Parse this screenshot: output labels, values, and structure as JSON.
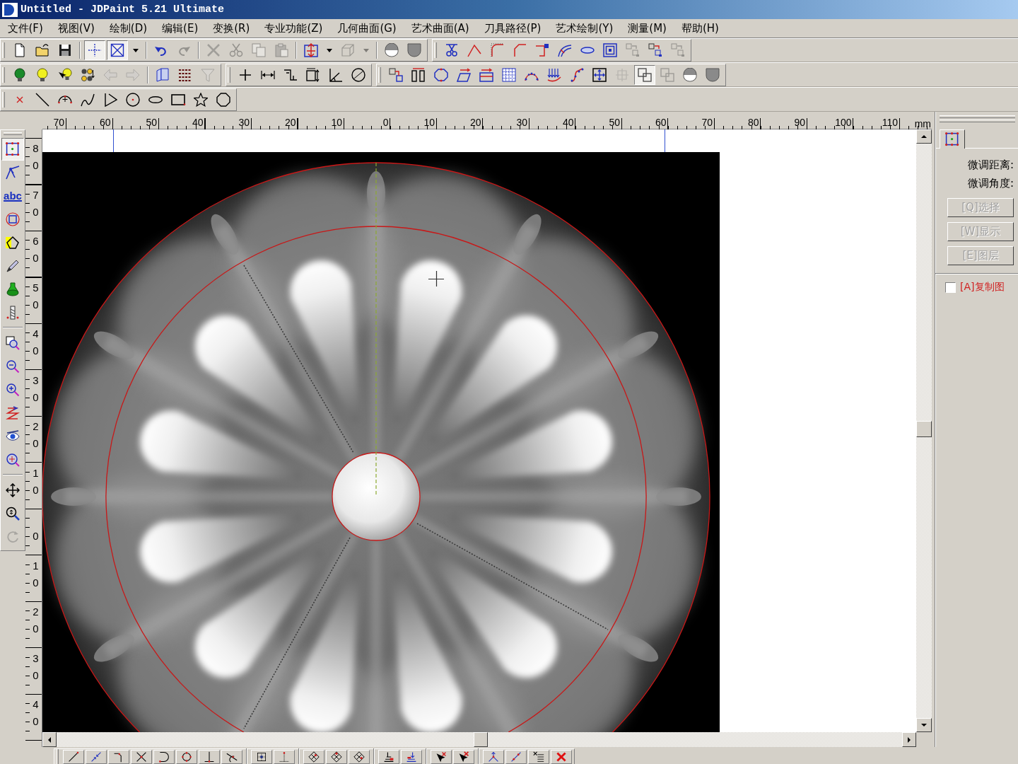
{
  "window": {
    "title": "Untitled - JDPaint 5.21 Ultimate"
  },
  "menu": [
    "文件(F)",
    "视图(V)",
    "绘制(D)",
    "编辑(E)",
    "变换(R)",
    "专业功能(Z)",
    "几何曲面(G)",
    "艺术曲面(A)",
    "刀具路径(P)",
    "艺术绘制(Y)",
    "测量(M)",
    "帮助(H)"
  ],
  "toolbar_rows": [
    {
      "toolbars": [
        {
          "groups": [
            [
              {
                "disabled": false,
                "pressed": false
              },
              {
                "disabled": false,
                "pressed": false
              },
              {
                "disabled": false,
                "pressed": false
              }
            ],
            [
              {
                "kind": "tool",
                "disabled": false,
                "pressed": true
              },
              {
                "kind": "tool",
                "disabled": false,
                "pressed": true
              },
              {
                "kind": "dropdown",
                "disabled": false,
                "pressed": false
              }
            ],
            [
              {
                "disabled": false,
                "pressed": false
              },
              {
                "disabled": true,
                "pressed": false
              }
            ],
            [
              {
                "disabled": true,
                "pressed": false
              },
              {
                "disabled": true,
                "pressed": false
              },
              {
                "disabled": true,
                "pressed": false
              },
              {
                "disabled": true,
                "pressed": false
              }
            ],
            [
              {
                "kind": "tool",
                "disabled": false,
                "pressed": false
              },
              {
                "kind": "dropdown",
                "disabled": false,
                "pressed": false
              },
              {
                "kind": "tool",
                "disabled": true,
                "pressed": false
              },
              {
                "kind": "dropdown",
                "disabled": true,
                "pressed": false
              }
            ],
            [
              {
                "disabled": false,
                "pressed": false
              },
              {
                "disabled": false,
                "pressed": false
              }
            ]
          ]
        },
        {
          "groups": [
            [
              {
                "disabled": false,
                "pressed": false
              },
              {
                "disabled": false,
                "pressed": false
              },
              {
                "disabled": false,
                "pressed": false
              },
              {
                "disabled": false,
                "pressed": false
              },
              {
                "disabled": false,
                "pressed": false
              },
              {
                "disabled": false,
                "pressed": false
              },
              {
                "disabled": false,
                "pressed": false
              },
              {
                "disabled": false,
                "pressed": false
              },
              {
                "disabled": true,
                "pressed": false
              },
              {
                "disabled": false,
                "pressed": false
              },
              {
                "disabled": true,
                "pressed": false
              }
            ]
          ]
        }
      ]
    },
    {
      "toolbars": [
        {
          "groups": [
            [
              {
                "disabled": false,
                "pressed": false
              },
              {
                "disabled": false,
                "pressed": false
              },
              {
                "disabled": false,
                "pressed": false
              },
              {
                "disabled": false,
                "pressed": false
              },
              {
                "disabled": true,
                "pressed": false
              },
              {
                "disabled": true,
                "pressed": false
              }
            ],
            [
              {
                "disabled": false,
                "pressed": false
              },
              {
                "disabled": false,
                "pressed": false
              },
              {
                "disabled": true,
                "pressed": false
              }
            ]
          ]
        },
        {
          "groups": [
            [
              {
                "disabled": false,
                "pressed": false
              },
              {
                "disabled": false,
                "pressed": false
              },
              {
                "disabled": false,
                "pressed": false
              },
              {
                "disabled": false,
                "pressed": false
              },
              {
                "disabled": false,
                "pressed": false
              },
              {
                "disabled": false,
                "pressed": false
              }
            ]
          ]
        },
        {
          "groups": [
            [
              {
                "disabled": false,
                "pressed": false
              },
              {
                "disabled": false,
                "pressed": false
              },
              {
                "disabled": false,
                "pressed": false
              },
              {
                "disabled": false,
                "pressed": false
              },
              {
                "disabled": false,
                "pressed": false
              },
              {
                "disabled": false,
                "pressed": false
              },
              {
                "disabled": false,
                "pressed": false
              },
              {
                "disabled": false,
                "pressed": false
              },
              {
                "disabled": false,
                "pressed": false
              },
              {
                "disabled": false,
                "pressed": false
              },
              {
                "disabled": true,
                "pressed": false
              },
              {
                "disabled": false,
                "pressed": true
              },
              {
                "disabled": true,
                "pressed": false
              },
              {
                "disabled": false,
                "pressed": false
              },
              {
                "disabled": false,
                "pressed": false
              }
            ]
          ]
        }
      ]
    },
    {
      "toolbars": [
        {
          "groups": [
            [
              {
                "disabled": false,
                "pressed": false
              },
              {
                "disabled": false,
                "pressed": false
              },
              {
                "disabled": false,
                "pressed": false
              },
              {
                "disabled": false,
                "pressed": false
              },
              {
                "disabled": false,
                "pressed": false
              },
              {
                "disabled": false,
                "pressed": false
              },
              {
                "disabled": false,
                "pressed": false
              },
              {
                "disabled": false,
                "pressed": false
              },
              {
                "disabled": false,
                "pressed": false
              },
              {
                "disabled": false,
                "pressed": false
              }
            ]
          ]
        }
      ]
    }
  ],
  "left_toolbar": {
    "groups": [
      [
        {
          "disabled": false,
          "pressed": true
        },
        {
          "disabled": false,
          "pressed": false
        },
        {
          "label": "abc",
          "disabled": false,
          "pressed": false
        },
        {
          "disabled": false,
          "pressed": false
        },
        {
          "disabled": false,
          "pressed": false
        },
        {
          "disabled": false,
          "pressed": false
        },
        {
          "disabled": false,
          "pressed": false
        },
        {
          "disabled": false,
          "pressed": false
        }
      ],
      [
        {
          "disabled": false,
          "pressed": false
        },
        {
          "disabled": false,
          "pressed": false
        },
        {
          "disabled": false,
          "pressed": false
        },
        {
          "disabled": false,
          "pressed": false
        },
        {
          "disabled": false,
          "pressed": false
        },
        {
          "disabled": false,
          "pressed": false
        }
      ],
      [
        {
          "disabled": false,
          "pressed": false
        },
        {
          "disabled": false,
          "pressed": false
        },
        {
          "disabled": true,
          "pressed": false
        }
      ]
    ]
  },
  "horizontal_ruler": {
    "labels": [
      "70",
      "60",
      "50",
      "40",
      "30",
      "20",
      "10",
      "0",
      "10",
      "20",
      "30",
      "40",
      "50",
      "60",
      "70",
      "80",
      "90",
      "100",
      "110"
    ],
    "unit": "mm"
  },
  "vertical_ruler": {
    "labels": [
      "80",
      "70",
      "60",
      "50",
      "40",
      "30",
      "20",
      "10",
      "0",
      "10",
      "20",
      "30",
      "40"
    ]
  },
  "side_panel": {
    "tabs": [
      {
        "selected": true
      }
    ],
    "fields": [
      "微调距离:",
      "微调角度:"
    ],
    "buttons": [
      {
        "label": "[Q]选择",
        "disabled": true
      },
      {
        "label": "[W]显示",
        "disabled": true
      },
      {
        "label": "[E]图层",
        "disabled": true
      }
    ],
    "checkbox": {
      "label": "[A]复制图",
      "checked": false
    }
  },
  "bottom_toolbar": {
    "groups": [
      [
        {
          "disabled": false,
          "pressed": false
        },
        {
          "disabled": false,
          "pressed": false
        },
        {
          "disabled": false,
          "pressed": false
        },
        {
          "disabled": false,
          "pressed": false
        },
        {
          "disabled": false,
          "pressed": false
        },
        {
          "disabled": false,
          "pressed": false
        },
        {
          "disabled": false,
          "pressed": false
        },
        {
          "disabled": false,
          "pressed": false
        }
      ],
      [
        {
          "disabled": false,
          "pressed": false
        },
        {
          "disabled": false,
          "pressed": false
        }
      ],
      [
        {
          "disabled": false,
          "pressed": false
        },
        {
          "disabled": false,
          "pressed": false
        },
        {
          "disabled": false,
          "pressed": false
        }
      ],
      [
        {
          "disabled": false,
          "pressed": false
        },
        {
          "disabled": false,
          "pressed": false
        }
      ],
      [
        {
          "disabled": false,
          "pressed": false
        },
        {
          "disabled": false,
          "pressed": false
        }
      ],
      [
        {
          "disabled": false,
          "pressed": false
        },
        {
          "disabled": false,
          "pressed": false
        },
        {
          "disabled": false,
          "pressed": false
        },
        {
          "disabled": false,
          "pressed": false
        }
      ]
    ]
  }
}
